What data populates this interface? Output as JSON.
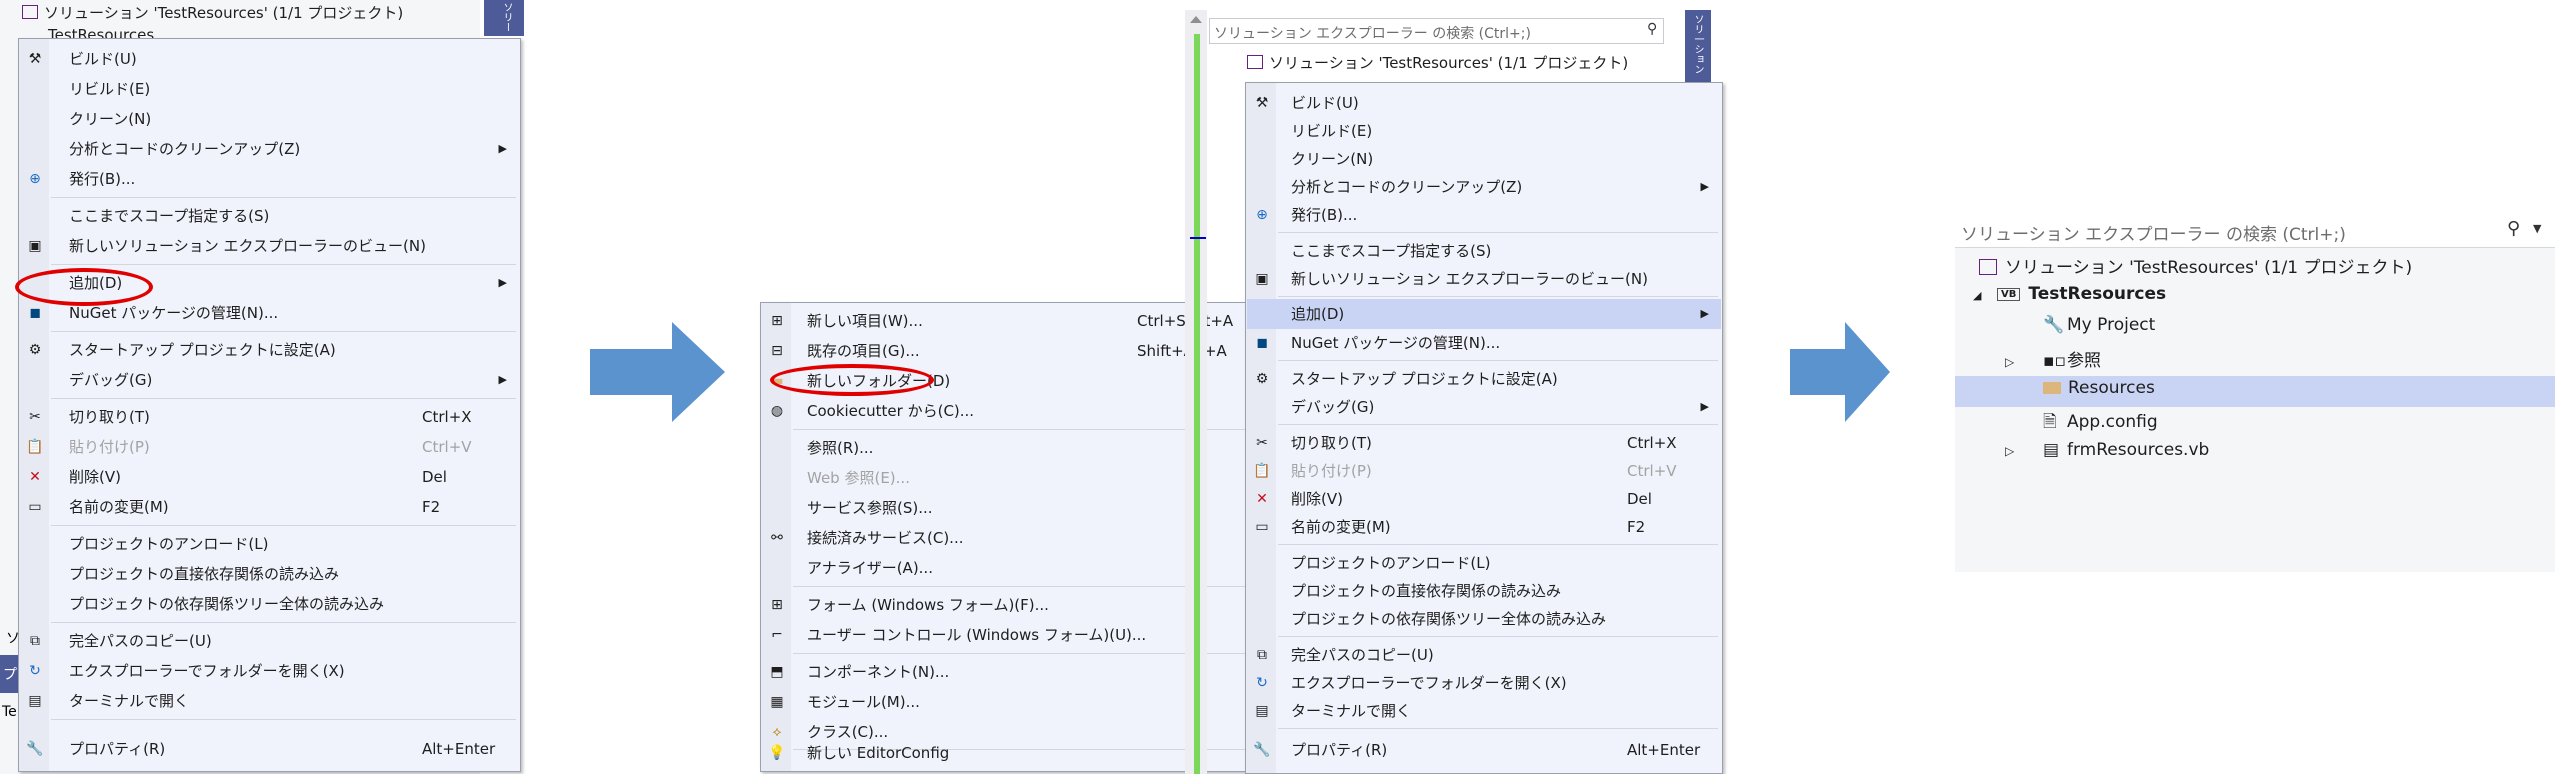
{
  "colors": {
    "menu_bg": "#f0f3fb",
    "highlight": "#c9d4f4",
    "annotation": "#e00000",
    "arrow": "#5b93cf",
    "vs_blue": "#4d5b99"
  },
  "panel1": {
    "solution_title": "ソリューション 'TestResources' (1/1 プロジェクト)",
    "project_partial": "TestResources",
    "left_edge_labels": [
      "ソ",
      "プ",
      "Te"
    ],
    "side_tab": "ソリー",
    "menu": {
      "build": "ビルド(U)",
      "rebuild": "リビルド(E)",
      "clean": "クリーン(N)",
      "analyze": "分析とコードのクリーンアップ(Z)",
      "publish": "発行(B)...",
      "scope": "ここまでスコープ指定する(S)",
      "new_view": "新しいソリューション エクスプローラーのビュー(N)",
      "add": "追加(D)",
      "nuget": "NuGet パッケージの管理(N)...",
      "startup": "スタートアップ プロジェクトに設定(A)",
      "debug": "デバッグ(G)",
      "cut": "切り取り(T)",
      "cut_sc": "Ctrl+X",
      "paste": "貼り付け(P)",
      "paste_sc": "Ctrl+V",
      "delete": "削除(V)",
      "delete_sc": "Del",
      "rename": "名前の変更(M)",
      "rename_sc": "F2",
      "unload": "プロジェクトのアンロード(L)",
      "load_direct": "プロジェクトの直接依存関係の読み込み",
      "load_tree": "プロジェクトの依存関係ツリー全体の読み込み",
      "copy_path": "完全パスのコピー(U)",
      "open_folder": "エクスプローラーでフォルダーを開く(X)",
      "terminal": "ターミナルで開く",
      "properties": "プロパティ(R)",
      "properties_sc": "Alt+Enter"
    }
  },
  "submenu": {
    "new_item": "新しい項目(W)...",
    "new_item_sc": "Ctrl+Shift+A",
    "existing_item": "既存の項目(G)...",
    "existing_item_sc": "Shift+Alt+A",
    "new_folder": "新しいフォルダー(D)",
    "cookiecutter": "Cookiecutter から(C)...",
    "reference": "参照(R)...",
    "web_reference": "Web 参照(E)...",
    "service_reference": "サービス参照(S)...",
    "connected_service": "接続済みサービス(C)...",
    "analyzer": "アナライザー(A)...",
    "form": "フォーム (Windows フォーム)(F)...",
    "user_control": "ユーザー コントロール (Windows フォーム)(U)...",
    "component": "コンポーネント(N)...",
    "module": "モジュール(M)...",
    "class": "クラス(C)...",
    "editorconfig": "新しい EditorConfig"
  },
  "panel3": {
    "search_placeholder": "ソリューション エクスプローラー の検索 (Ctrl+;)",
    "solution_title": "ソリューション 'TestResources' (1/1 プロジェクト)",
    "side_tab": "ソリ一ション"
  },
  "panel4": {
    "search_placeholder": "ソリューション エクスプローラー の検索 (Ctrl+;)",
    "solution": "ソリューション 'TestResources' (1/1 プロジェクト)",
    "vb_badge": "VB",
    "project": "TestResources",
    "my_project": "My Project",
    "references": "参照",
    "resources": "Resources",
    "app_config": "App.config",
    "form_file": "frmResources.vb"
  }
}
